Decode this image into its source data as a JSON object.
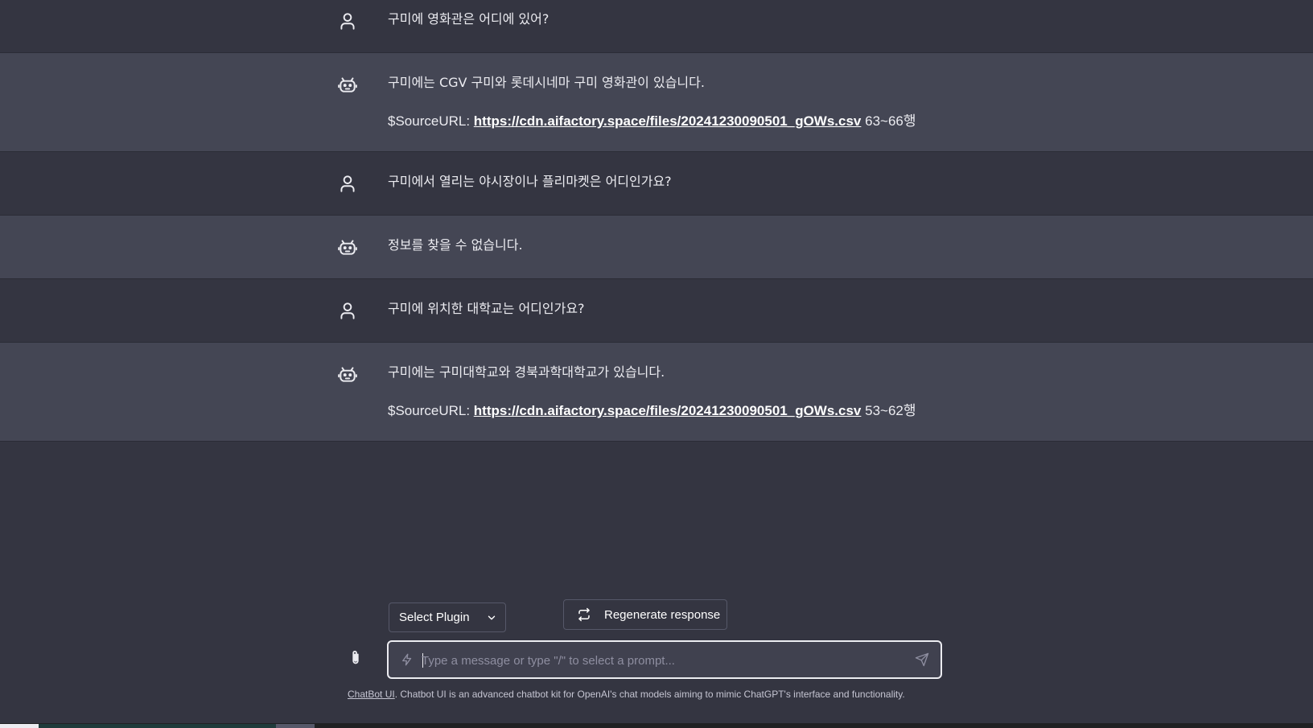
{
  "messages": [
    {
      "role": "user",
      "text": "구미에 영화관은 어디에 있어?"
    },
    {
      "role": "assistant",
      "text": "구미에는 CGV 구미와 롯데시네마 구미 영화관이 있습니다.",
      "source_prefix": "$SourceURL: ",
      "source_url": "https://cdn.aifactory.space/files/20241230090501_gOWs.csv",
      "source_lines": " 63~66행"
    },
    {
      "role": "user",
      "text": "구미에서 열리는 야시장이나 플리마켓은 어디인가요?"
    },
    {
      "role": "assistant",
      "text": "정보를 찾을 수 없습니다."
    },
    {
      "role": "user",
      "text": "구미에 위치한 대학교는 어디인가요?"
    },
    {
      "role": "assistant",
      "text": "구미에는 구미대학교와 경북과학대학교가 있습니다.",
      "source_prefix": "$SourceURL: ",
      "source_url": "https://cdn.aifactory.space/files/20241230090501_gOWs.csv",
      "source_lines": " 53~62행"
    }
  ],
  "controls": {
    "plugin_select_label": "Select Plugin",
    "regenerate_label": "Regenerate response",
    "input_placeholder": "Type a message or type \"/\" to select a prompt..."
  },
  "footer": {
    "link_text": "ChatBot UI",
    "text": ". Chatbot UI is an advanced chatbot kit for OpenAI's chat models aiming to mimic ChatGPT's interface and functionality."
  },
  "icons": {
    "user": "user-icon",
    "assistant": "robot-icon",
    "attach": "paperclip-icon",
    "prompt": "bolt-icon",
    "send": "send-icon",
    "regenerate": "refresh-icon",
    "dropdown": "chevron-down-icon"
  }
}
